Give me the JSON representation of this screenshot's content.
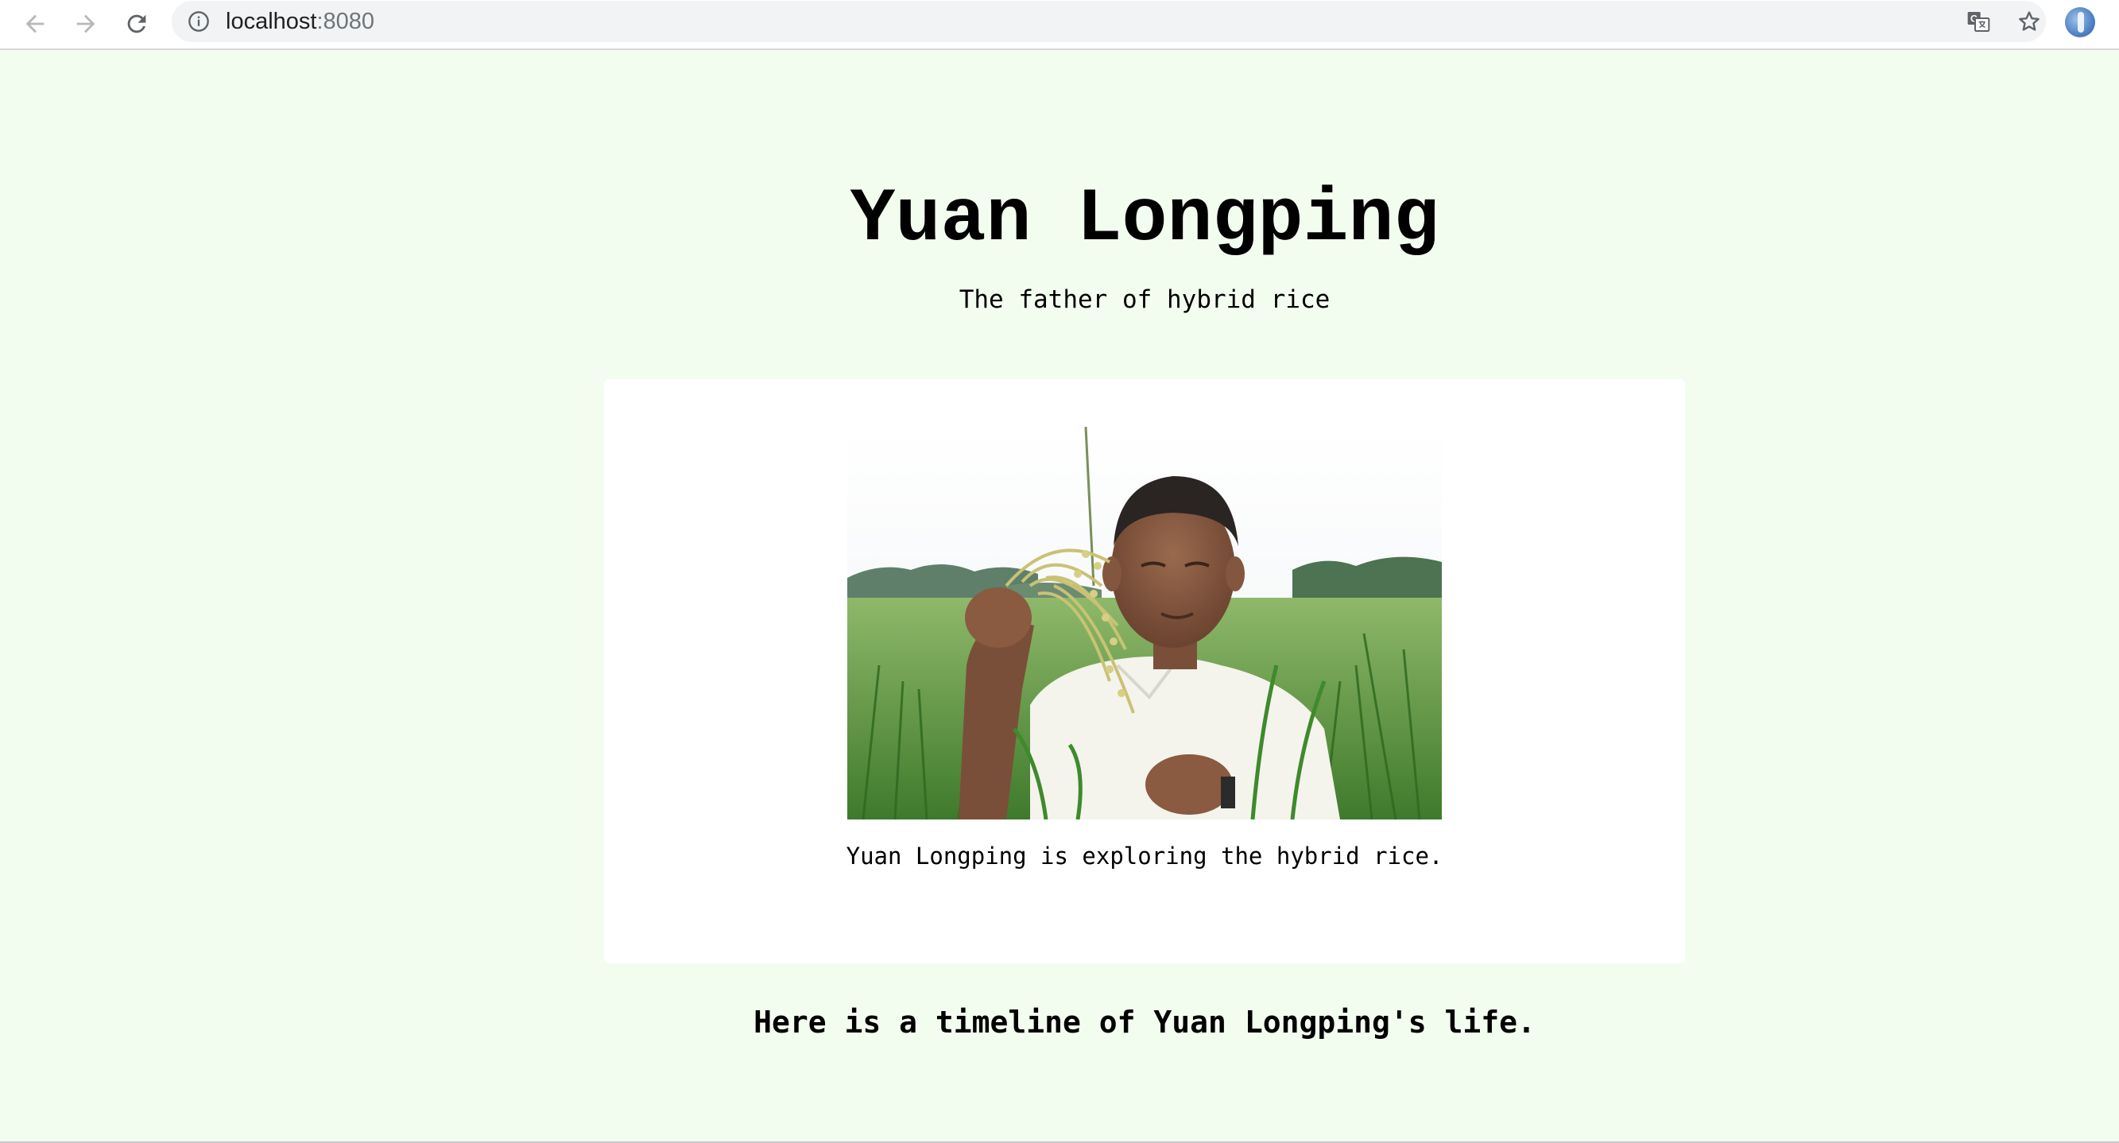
{
  "browser": {
    "url_host": "localhost",
    "url_port": ":8080",
    "back_icon": "arrow-left-icon",
    "forward_icon": "arrow-right-icon",
    "reload_icon": "reload-icon",
    "info_icon": "info-icon",
    "translate_icon": "translate-icon",
    "bookmark_icon": "star-icon",
    "profile_icon": "profile-avatar"
  },
  "page": {
    "title": "Yuan Longping",
    "subtitle": "The father of hybrid rice",
    "figure": {
      "caption": "Yuan Longping is exploring the hybrid rice."
    },
    "timeline_heading": "Here is a timeline of Yuan Longping's life."
  },
  "colors": {
    "page_background": "#f3fdef",
    "card_background": "#ffffff",
    "text": "#000000"
  }
}
